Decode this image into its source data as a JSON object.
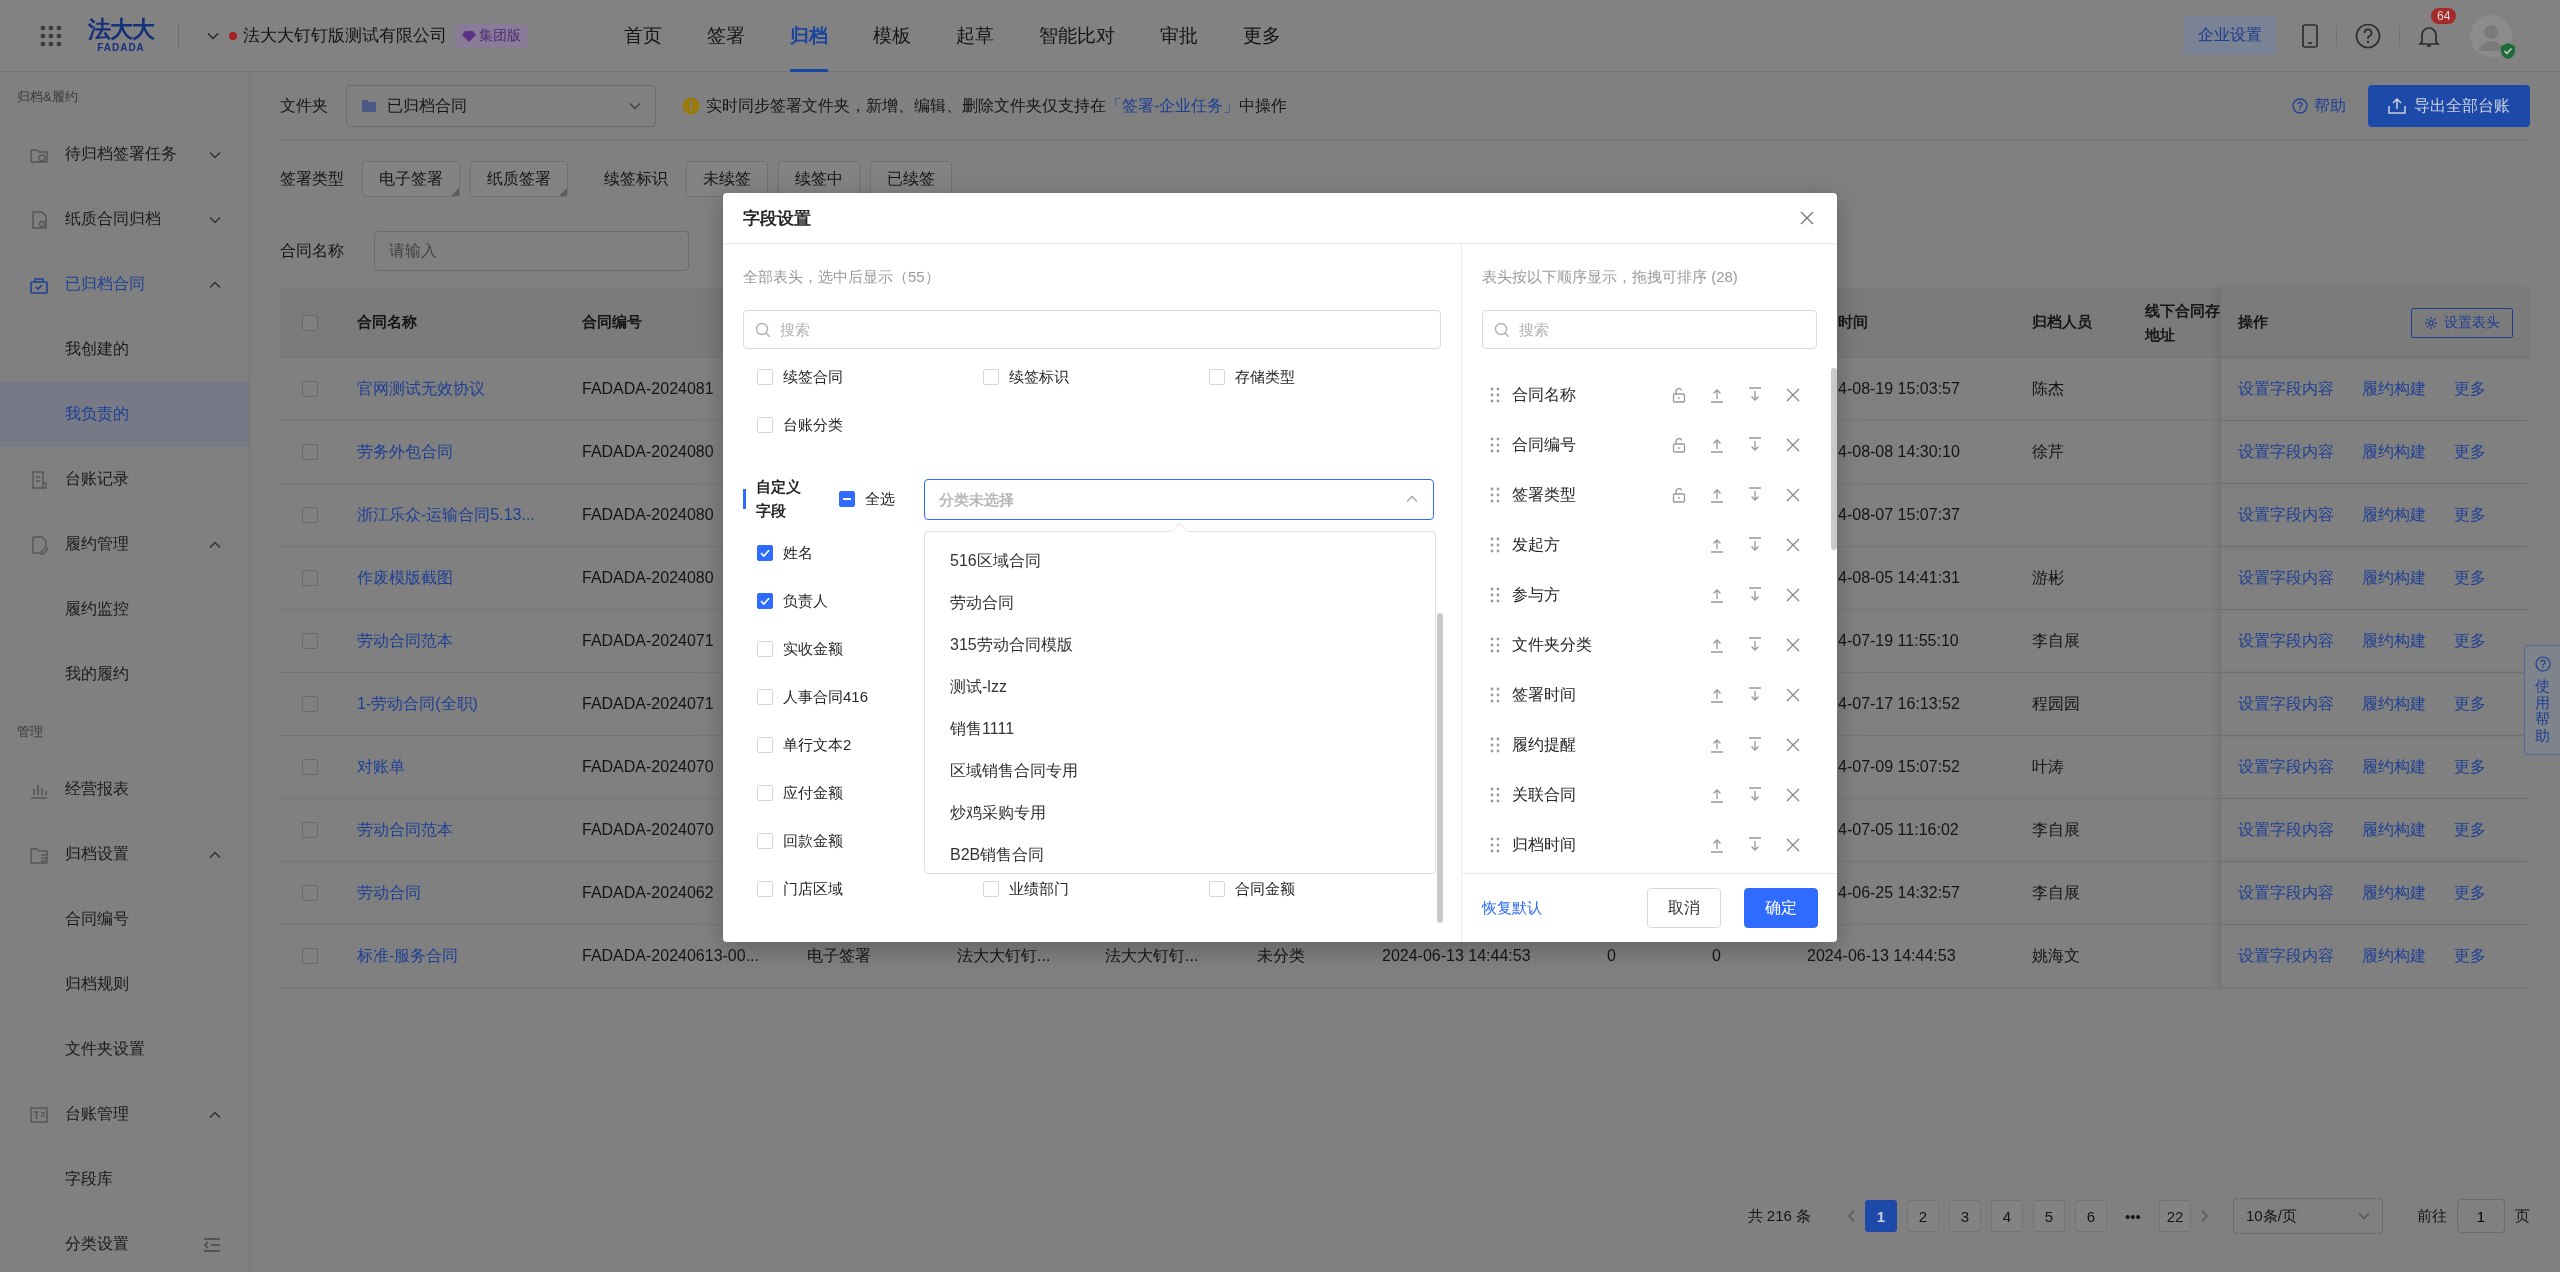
{
  "header": {
    "logo": {
      "name": "法大大",
      "subtitle": "FADADA"
    },
    "company": "法大大钉钉版测试有限公司",
    "edition_badge": "集团版",
    "nav": [
      {
        "label": "首页",
        "selected": false
      },
      {
        "label": "签署",
        "selected": false
      },
      {
        "label": "归档",
        "selected": true
      },
      {
        "label": "模板",
        "selected": false
      },
      {
        "label": "起草",
        "selected": false
      },
      {
        "label": "智能比对",
        "selected": false
      },
      {
        "label": "审批",
        "selected": false
      },
      {
        "label": "更多",
        "selected": false
      }
    ],
    "settings_button": "企业设置",
    "notification_count": "64"
  },
  "sidebar": {
    "sections": [
      {
        "title": "归档&履约",
        "items": [
          {
            "label": "待归档签署任务",
            "selected": false,
            "expanded": false
          },
          {
            "label": "纸质合同归档",
            "selected": false,
            "expanded": false
          },
          {
            "label": "已归档合同",
            "selected": true,
            "expanded": true,
            "children": [
              {
                "label": "我创建的",
                "selected": false
              },
              {
                "label": "我负责的",
                "selected": true
              }
            ]
          },
          {
            "label": "台账记录",
            "selected": false
          },
          {
            "label": "履约管理",
            "selected": false,
            "expanded": true,
            "children": [
              {
                "label": "履约监控",
                "selected": false
              },
              {
                "label": "我的履约",
                "selected": false
              }
            ]
          }
        ]
      },
      {
        "title": "管理",
        "items": [
          {
            "label": "经营报表",
            "selected": false
          },
          {
            "label": "归档设置",
            "selected": false,
            "expanded": true,
            "children": [
              {
                "label": "合同编号",
                "selected": false
              },
              {
                "label": "归档规则",
                "selected": false
              },
              {
                "label": "文件夹设置",
                "selected": false
              }
            ]
          },
          {
            "label": "台账管理",
            "selected": false,
            "expanded": true,
            "children": [
              {
                "label": "字段库",
                "selected": false
              },
              {
                "label": "分类设置",
                "selected": false
              }
            ]
          }
        ]
      }
    ]
  },
  "toolbar": {
    "folder_label": "文件夹",
    "folder_value": "已归档合同",
    "notice": {
      "text": "实时同步签署文件夹，新增、编辑、删除文件夹仅支持在",
      "link": "「签署-企业任务」",
      "suffix": "中操作"
    },
    "help_link": "帮助",
    "export_button": "导出全部台账"
  },
  "filters": {
    "groups": [
      {
        "label": "签署类型",
        "kind": "multi",
        "tags": [
          {
            "label": "电子签署",
            "selected": false
          },
          {
            "label": "纸质签署",
            "selected": false
          }
        ]
      },
      {
        "label": "续签标识",
        "kind": "single",
        "tags": [
          {
            "label": "未续签",
            "selected": false
          },
          {
            "label": "续签中",
            "selected": false
          },
          {
            "label": "已续签",
            "selected": false
          }
        ]
      }
    ],
    "name_label": "合同名称",
    "name_placeholder": "请输入"
  },
  "table": {
    "select_all_checked": false,
    "headers": {
      "name": "合同名称",
      "number": "合同编号",
      "archive_time": "时间",
      "archiver": "归档人员",
      "offline_address": "线下合同存地址",
      "actions": "操作",
      "settings_button": "设置表头"
    },
    "rows": [
      {
        "kind": "covered",
        "checked": false,
        "name": "官网测试无效协议",
        "number": "FADADA-2024081",
        "archive_time": "4-08-19 15:03:57",
        "archiver": "陈杰",
        "actions": [
          "设置字段内容",
          "履约构建",
          "更多"
        ]
      },
      {
        "kind": "covered",
        "checked": false,
        "name": "劳务外包合同",
        "number": "FADADA-2024080",
        "archive_time": "4-08-08 14:30:10",
        "archiver": "徐芹",
        "actions": [
          "设置字段内容",
          "履约构建",
          "更多"
        ]
      },
      {
        "kind": "covered",
        "checked": false,
        "name": "浙江乐众-运输合同5.13...",
        "number": "FADADA-2024080",
        "archive_time": "4-08-07 15:07:37",
        "actions": [
          "设置字段内容",
          "履约构建",
          "更多"
        ]
      },
      {
        "kind": "covered",
        "checked": false,
        "name": "作废模版截图",
        "number": "FADADA-2024080",
        "archive_time": "4-08-05 14:41:31",
        "archiver": "游彬",
        "actions": [
          "设置字段内容",
          "履约构建",
          "更多"
        ]
      },
      {
        "kind": "covered",
        "checked": false,
        "name": "劳动合同范本",
        "number": "FADADA-2024071",
        "archive_time": "4-07-19 11:55:10",
        "archiver": "李自展",
        "actions": [
          "设置字段内容",
          "履约构建",
          "更多"
        ]
      },
      {
        "kind": "covered",
        "checked": false,
        "name": "1-劳动合同(全职)",
        "number": "FADADA-2024071",
        "archive_time": "4-07-17 16:13:52",
        "archiver": "程园园",
        "actions": [
          "设置字段内容",
          "履约构建",
          "更多"
        ]
      },
      {
        "kind": "covered",
        "checked": false,
        "name": "对账单",
        "number": "FADADA-2024070",
        "archive_time": "4-07-09 15:07:52",
        "archiver": "叶涛",
        "actions": [
          "设置字段内容",
          "履约构建",
          "更多"
        ]
      },
      {
        "kind": "covered",
        "checked": false,
        "name": "劳动合同范本",
        "number": "FADADA-2024070",
        "archive_time": "4-07-05 11:16:02",
        "archiver": "李自展",
        "actions": [
          "设置字段内容",
          "履约构建",
          "更多"
        ]
      },
      {
        "kind": "covered",
        "checked": false,
        "name": "劳动合同",
        "number": "FADADA-2024062",
        "archive_time": "4-06-25 14:32:57",
        "archiver": "李自展",
        "actions": [
          "设置字段内容",
          "履约构建",
          "更多"
        ]
      },
      {
        "kind": "full",
        "checked": false,
        "name": "标准-服务合同",
        "number": "FADADA-20240613-00...",
        "column_4": "电子签署",
        "column_5": "法大大钉钉...",
        "column_6": "法大大钉钉...",
        "column_7": "未分类",
        "column_8": "2024-06-13 14:44:53",
        "column_9": "0",
        "column_10": "0",
        "archive_time": "2024-06-13 14:44:53",
        "archiver": "姚海文",
        "actions": [
          "设置字段内容",
          "履约构建",
          "更多"
        ]
      }
    ]
  },
  "pagination": {
    "total": "共 216 条",
    "pages": [
      {
        "label": "1",
        "kind": "page",
        "selected": true
      },
      {
        "label": "2",
        "kind": "page",
        "selected": false
      },
      {
        "label": "3",
        "kind": "page",
        "selected": false
      },
      {
        "label": "4",
        "kind": "page",
        "selected": false
      },
      {
        "label": "5",
        "kind": "page",
        "selected": false
      },
      {
        "label": "6",
        "kind": "page",
        "selected": false
      },
      {
        "label": "•••",
        "kind": "ellipsis",
        "selected": false
      },
      {
        "label": "22",
        "kind": "page",
        "selected": false
      }
    ],
    "page_size": "10条/页",
    "goto_label": "前往",
    "goto_value": "1",
    "goto_suffix": "页"
  },
  "help_tab": "使用帮助",
  "modal": {
    "title": "字段设置",
    "all_columns": {
      "subtitle": "全部表头，选中后显示（55）",
      "search_placeholder": "搜索",
      "fields": [
        {
          "label": "续签合同",
          "checked": false
        },
        {
          "label": "续签标识",
          "checked": false
        },
        {
          "label": "存储类型",
          "checked": false
        },
        {
          "label": "台账分类",
          "checked": false
        }
      ],
      "custom_section": {
        "title": "自定义字段",
        "select_all": {
          "label": "全选",
          "indeterminate": true
        },
        "category_select": {
          "placeholder": "分类未选择",
          "open": true
        },
        "rows": [
          [
            {
              "label": "姓名",
              "checked": true
            }
          ],
          [
            {
              "label": "负责人",
              "checked": true
            }
          ],
          [
            {
              "label": "实收金额",
              "checked": false
            }
          ],
          [
            {
              "label": "人事合同416",
              "checked": false
            }
          ],
          [
            {
              "label": "单行文本2",
              "checked": false
            }
          ],
          [
            {
              "label": "应付金额",
              "checked": false
            }
          ],
          [
            {
              "label": "回款金额",
              "checked": false
            }
          ],
          [
            {
              "label": "门店区域",
              "checked": false
            },
            {
              "label": "业绩部门",
              "checked": false
            },
            {
              "label": "合同金额",
              "checked": false
            }
          ]
        ]
      },
      "category_options": [
        "516区域合同",
        "劳动合同",
        "315劳动合同模版",
        "测试-lzz",
        "销售1111",
        "区域销售合同专用",
        "炒鸡采购专用",
        "B2B销售合同"
      ]
    },
    "shown_columns": {
      "subtitle": "表头按以下顺序显示，拖拽可排序 (28)",
      "search_placeholder": "搜索",
      "items": [
        {
          "label": "合同名称",
          "lockable": true
        },
        {
          "label": "合同编号",
          "lockable": true
        },
        {
          "label": "签署类型",
          "lockable": true
        },
        {
          "label": "发起方",
          "lockable": false
        },
        {
          "label": "参与方",
          "lockable": false
        },
        {
          "label": "文件夹分类",
          "lockable": false
        },
        {
          "label": "签署时间",
          "lockable": false
        },
        {
          "label": "履约提醒",
          "lockable": false
        },
        {
          "label": "关联合同",
          "lockable": false
        },
        {
          "label": "归档时间",
          "lockable": false
        }
      ]
    },
    "footer": {
      "reset": "恢复默认",
      "cancel": "取消",
      "confirm": "确定"
    }
  }
}
